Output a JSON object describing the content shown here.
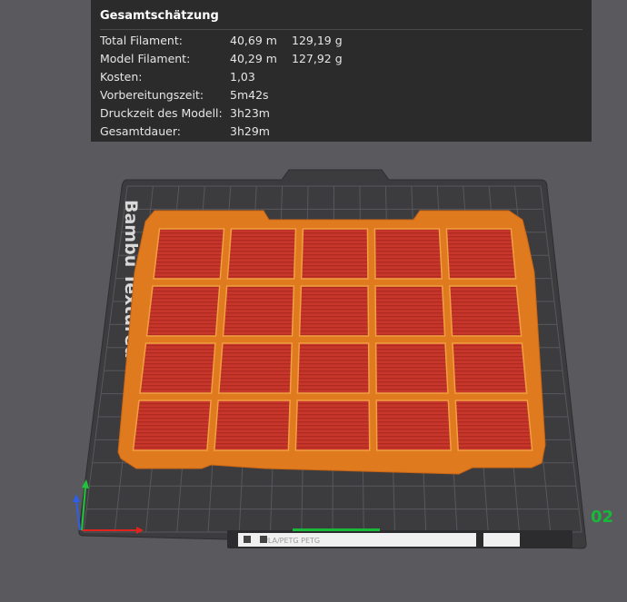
{
  "estimate": {
    "title": "Gesamtschätzung",
    "rows": [
      {
        "label": "Total Filament:",
        "value": "40,69 m",
        "value2": "129,19 g"
      },
      {
        "label": "Model Filament:",
        "value": "40,29 m",
        "value2": "127,92 g"
      },
      {
        "label": "Kosten:",
        "value": "1,03",
        "value2": ""
      },
      {
        "label": "Vorbereitungszeit:",
        "value": "5m42s",
        "value2": ""
      },
      {
        "label": "Druckzeit des Modell:",
        "value": "3h23m",
        "value2": ""
      },
      {
        "label": "Gesamtdauer:",
        "value": "3h29m",
        "value2": ""
      }
    ]
  },
  "plate": {
    "number": "02",
    "bed_label": "Bambu Textured PEI Plate",
    "filament_label": "PLA/PETG PETG"
  },
  "colors": {
    "background": "#5a5a5e",
    "panel": "#2b2b2b",
    "bed": "#3c3c3f",
    "grid": "#58585c",
    "model_orange": "#e07a1f",
    "model_red": "#c7362a",
    "plate_number": "#18b83a",
    "axis_x": "#e0231f",
    "axis_y": "#1fc43a",
    "axis_z": "#2f5fe8"
  }
}
